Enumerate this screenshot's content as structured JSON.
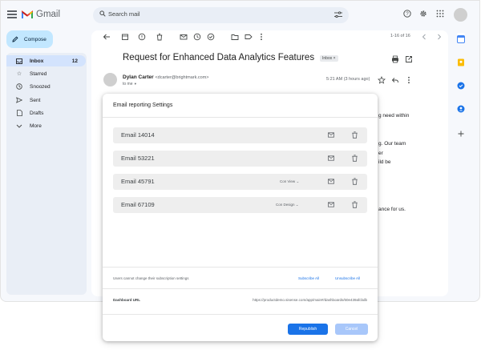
{
  "app": {
    "name": "Gmail"
  },
  "search": {
    "placeholder": "Search mail"
  },
  "compose": {
    "label": "Compose"
  },
  "sidebar": {
    "items": [
      {
        "label": "Inbox",
        "count": "12",
        "icon": "inbox-icon"
      },
      {
        "label": "Starred",
        "icon": "star-icon"
      },
      {
        "label": "Snoozed",
        "icon": "clock-icon"
      },
      {
        "label": "Sent",
        "icon": "send-icon"
      },
      {
        "label": "Drafts",
        "icon": "draft-icon"
      },
      {
        "label": "More",
        "icon": "chevron-down-icon"
      }
    ]
  },
  "toolbar": {
    "pager": "1-16 of 16"
  },
  "message": {
    "subject": "Request for Enhanced Data Analytics Features",
    "label_chip": "Inbox ×",
    "sender_name": "Dylan Carter",
    "sender_email": "<dcarter@brightmark.com>",
    "to": "to me",
    "time": "5:21 AM (3 hours ago)",
    "body_fragments": [
      "g need within",
      "g. Our team",
      "er",
      "ild be",
      "ance for us."
    ]
  },
  "modal": {
    "title": "Email reporting Settings",
    "rows": [
      {
        "name": "Email 14014",
        "dropdown": ""
      },
      {
        "name": "Email 53221",
        "dropdown": ""
      },
      {
        "name": "Email 45791",
        "dropdown": "Con View"
      },
      {
        "name": "Email 67109",
        "dropdown": "Con Design"
      }
    ],
    "footer_note": "Users cannot change their subscription settings",
    "subscribe_all": "Subscribe All",
    "unsubscribe_all": "Unsubscribe All",
    "dashboard_label": "Dashboard URL",
    "dashboard_url": "https://productdemo.sisense.com/app/main#/dashboards/60e439afcbdb",
    "republish": "Republish",
    "cancel": "Cancel"
  },
  "colors": {
    "accent": "#1a73e8",
    "compose_bg": "#c2e7ff",
    "active_nav": "#d3e3fd"
  }
}
